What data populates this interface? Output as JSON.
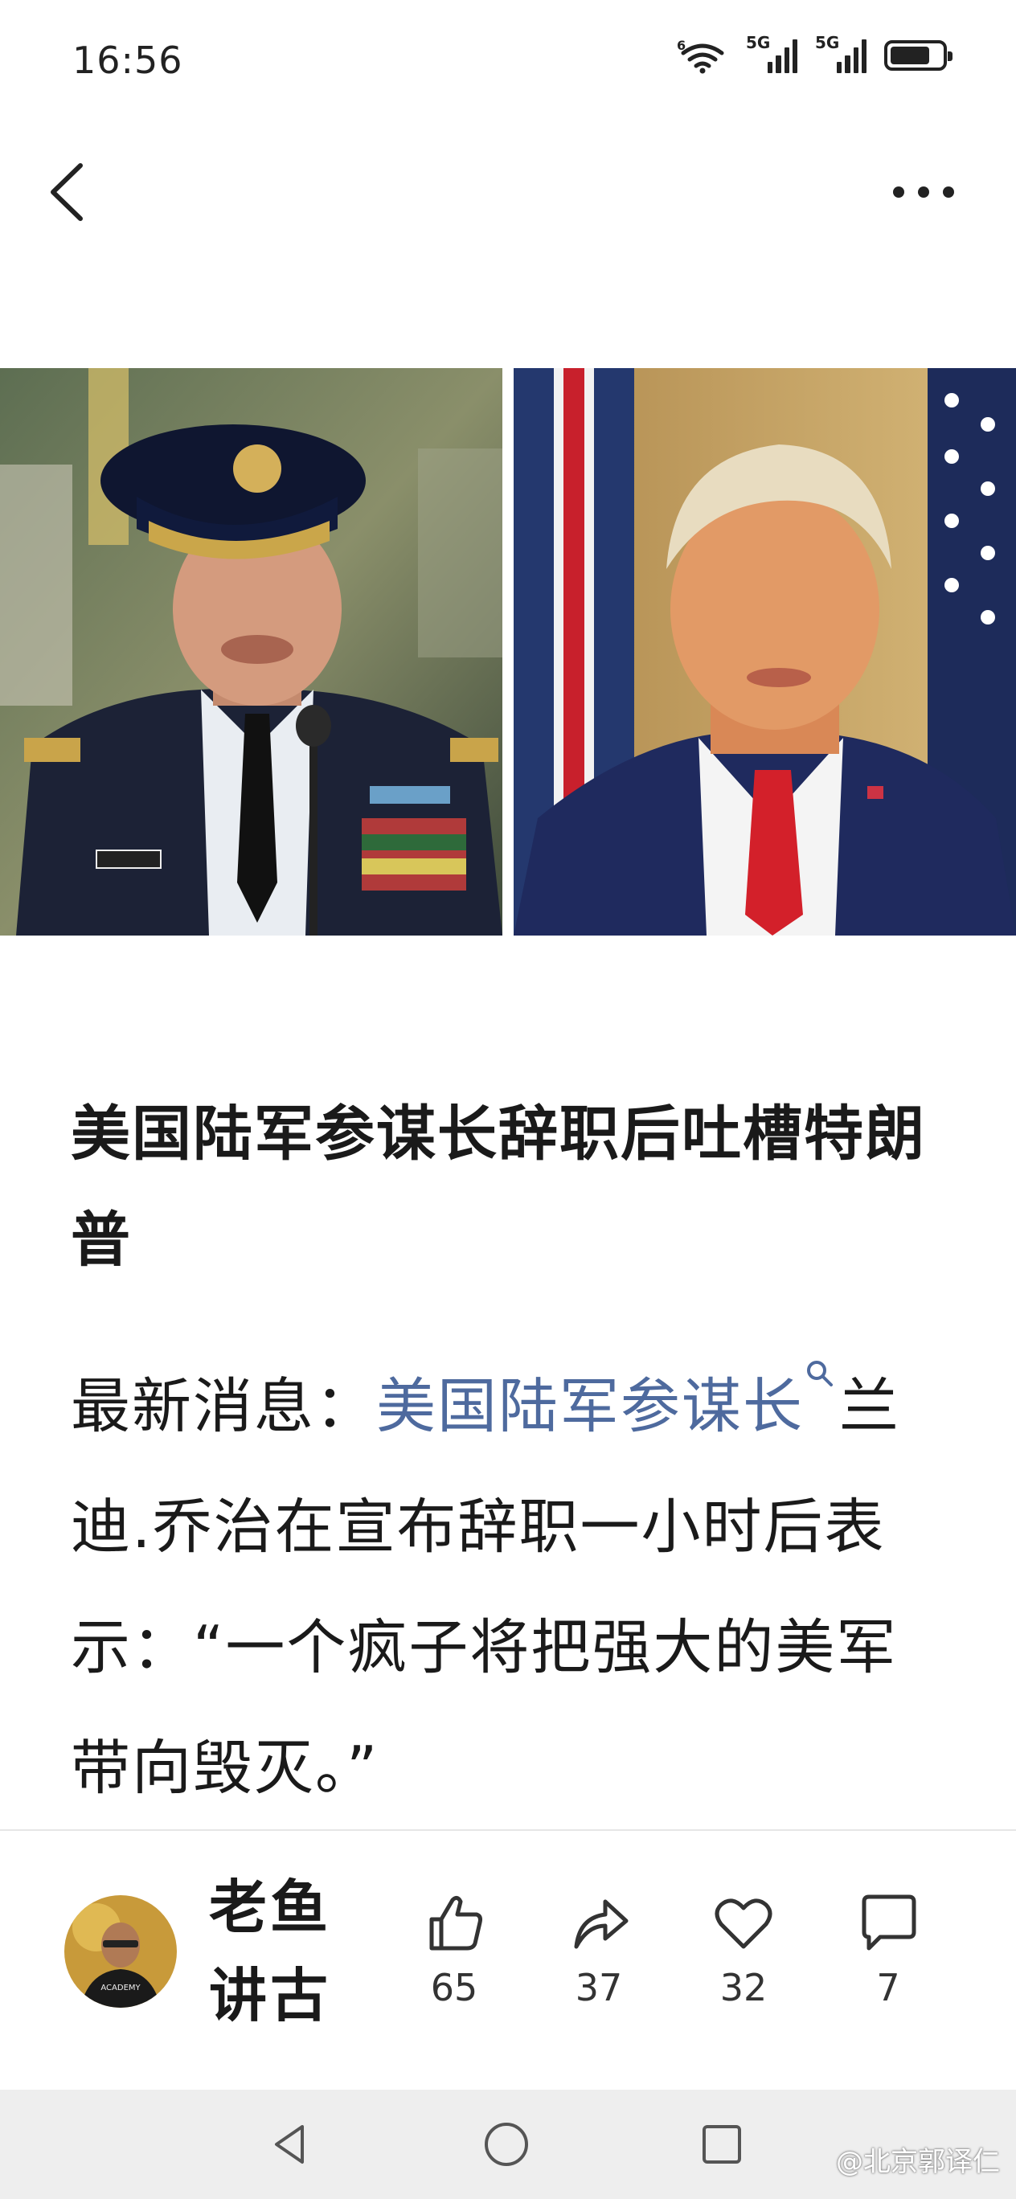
{
  "status_bar": {
    "time": "16:56",
    "wifi_label": "6",
    "signal_1_label": "5G",
    "signal_2_label": "5G"
  },
  "nav": {
    "back_icon": "chevron-left-icon",
    "more_icon": "more-horizontal-icon"
  },
  "article": {
    "headline": "美国陆军参谋长辞职后吐槽特朗普",
    "body_prefix": "最新消息：",
    "body_link": "美国陆军参谋长",
    "body_rest": "兰迪.乔治在宣布辞职一小时后表示：“一个疯子将把强大的美军带向毁灭。”"
  },
  "author": {
    "name": "老鱼讲古",
    "shirt_text": "ACADEMY"
  },
  "actions": [
    {
      "icon": "thumbs-up-icon",
      "count": "65"
    },
    {
      "icon": "share-icon",
      "count": "37"
    },
    {
      "icon": "heart-icon",
      "count": "32"
    },
    {
      "icon": "comment-icon",
      "count": "7"
    }
  ],
  "system_nav": {
    "watermark": "@北京郭译仁"
  },
  "colors": {
    "link": "#4e6a9e",
    "text": "#1a1a1a",
    "nav_bg": "#eeeeee"
  }
}
